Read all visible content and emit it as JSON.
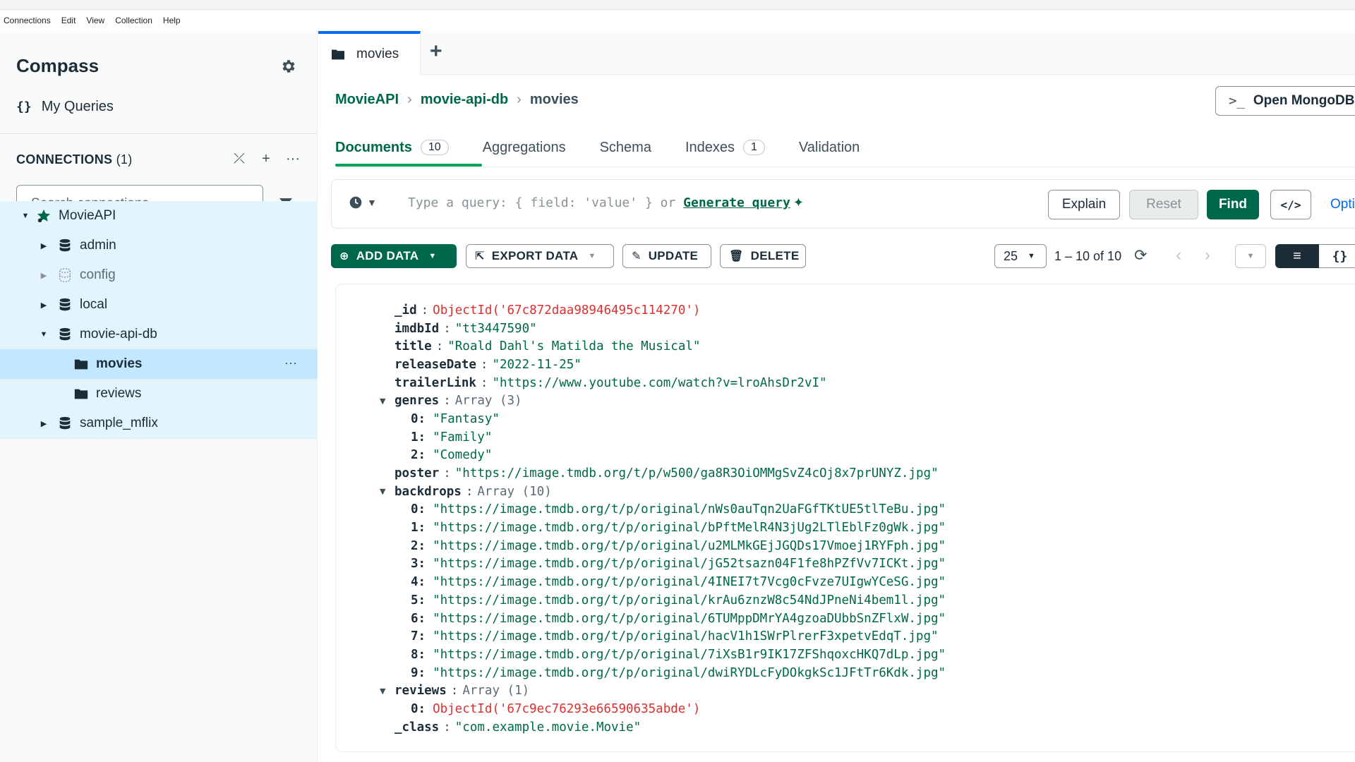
{
  "menu": [
    "Connections",
    "Edit",
    "View",
    "Collection",
    "Help"
  ],
  "sidebar": {
    "brand": "Compass",
    "my_queries": "My Queries",
    "my_queries_icon": "{}",
    "connections_title": "CONNECTIONS",
    "connections_count": "(1)",
    "search_placeholder": "Search connections",
    "tree": [
      {
        "label": "MovieAPI",
        "icon": "connection-star-icon",
        "level": 0,
        "expanded": true
      },
      {
        "label": "admin",
        "icon": "database-icon",
        "level": 1,
        "expanded": false
      },
      {
        "label": "config",
        "icon": "database-dotted-icon",
        "level": 1,
        "expanded": false,
        "muted": true
      },
      {
        "label": "local",
        "icon": "database-icon",
        "level": 1,
        "expanded": false
      },
      {
        "label": "movie-api-db",
        "icon": "database-icon",
        "level": 1,
        "expanded": true
      },
      {
        "label": "movies",
        "icon": "folder-icon",
        "level": 2,
        "selected": true
      },
      {
        "label": "reviews",
        "icon": "folder-icon",
        "level": 2
      },
      {
        "label": "sample_mflix",
        "icon": "database-icon",
        "level": 1,
        "expanded": false
      }
    ]
  },
  "tabs": {
    "active": "movies",
    "plus": "+"
  },
  "breadcrumb": {
    "connection": "MovieAPI",
    "database": "movie-api-db",
    "collection": "movies"
  },
  "open_shell": "Open MongoDB",
  "subtabs": [
    {
      "label": "Documents",
      "badge": "10",
      "active": true
    },
    {
      "label": "Aggregations",
      "badge": ""
    },
    {
      "label": "Schema",
      "badge": ""
    },
    {
      "label": "Indexes",
      "badge": "1"
    },
    {
      "label": "Validation",
      "badge": ""
    }
  ],
  "query": {
    "placeholder": "Type a query: { field: 'value' } or",
    "generate": "Generate query",
    "explain": "Explain",
    "reset": "Reset",
    "find": "Find",
    "options": "Optio"
  },
  "toolbar": {
    "add_data": "ADD DATA",
    "export_data": "EXPORT DATA",
    "update": "UPDATE",
    "delete": "DELETE",
    "page_size": "25",
    "page_range": "1 – 10 of 10"
  },
  "document": {
    "_id": "ObjectId('67c872daa98946495c114270')",
    "imdbId": "\"tt3447590\"",
    "title": "\"Roald Dahl's Matilda the Musical\"",
    "releaseDate": "\"2022-11-25\"",
    "trailerLink": "\"https://www.youtube.com/watch?v=lroAhsDr2vI\"",
    "genres_label": "Array (3)",
    "genres": [
      "\"Fantasy\"",
      "\"Family\"",
      "\"Comedy\""
    ],
    "poster": "\"https://image.tmdb.org/t/p/w500/ga8R3OiOMMgSvZ4cOj8x7prUNYZ.jpg\"",
    "backdrops_label": "Array (10)",
    "backdrops": [
      "\"https://image.tmdb.org/t/p/original/nWs0auTqn2UaFGfTKtUE5tlTeBu.jpg\"",
      "\"https://image.tmdb.org/t/p/original/bPftMelR4N3jUg2LTlEblFz0gWk.jpg\"",
      "\"https://image.tmdb.org/t/p/original/u2MLMkGEjJGQDs17Vmoej1RYFph.jpg\"",
      "\"https://image.tmdb.org/t/p/original/jG52tsazn04F1fe8hPZfVv7ICKt.jpg\"",
      "\"https://image.tmdb.org/t/p/original/4INEI7t7Vcg0cFvze7UIgwYCeSG.jpg\"",
      "\"https://image.tmdb.org/t/p/original/krAu6znzW8c54NdJPneNi4bem1l.jpg\"",
      "\"https://image.tmdb.org/t/p/original/6TUMppDMrYA4gzoaDUbbSnZFlxW.jpg\"",
      "\"https://image.tmdb.org/t/p/original/hacV1h1SWrPlrerF3xpetvEdqT.jpg\"",
      "\"https://image.tmdb.org/t/p/original/7iXsB1r9IK17ZFShqoxcHKQ7dLp.jpg\"",
      "\"https://image.tmdb.org/t/p/original/dwiRYDLcFyDOkgkSc1JFtTr6Kdk.jpg\""
    ],
    "reviews_label": "Array (1)",
    "reviews": [
      "ObjectId('67c9ec76293e66590635abde')"
    ],
    "_class": "\"com.example.movie.Movie\""
  },
  "colors": {
    "green": "#00684a",
    "selected_bg": "#c3e7fe",
    "tree_bg": "#e3f4fd",
    "objectid": "#db3030",
    "tab_accent": "#016bf8"
  }
}
